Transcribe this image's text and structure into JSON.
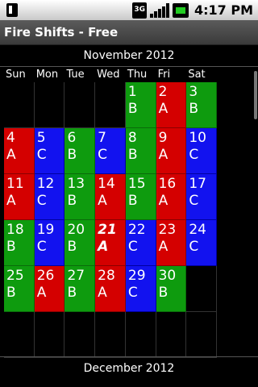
{
  "status_bar": {
    "network": "3G",
    "time": "4:17 PM"
  },
  "app": {
    "title": "Fire Shifts - Free"
  },
  "calendar": {
    "month_title": "November 2012",
    "next_month_title": "December 2012",
    "weekdays": [
      "Sun",
      "Mon",
      "Tue",
      "Wed",
      "Thu",
      "Fri",
      "Sat"
    ],
    "weeks": [
      [
        {
          "day": "",
          "shift": "",
          "color": "empty"
        },
        {
          "day": "",
          "shift": "",
          "color": "empty"
        },
        {
          "day": "",
          "shift": "",
          "color": "empty"
        },
        {
          "day": "",
          "shift": "",
          "color": "empty"
        },
        {
          "day": "1",
          "shift": "B",
          "color": "green"
        },
        {
          "day": "2",
          "shift": "A",
          "color": "red"
        },
        {
          "day": "3",
          "shift": "B",
          "color": "green"
        }
      ],
      [
        {
          "day": "4",
          "shift": "A",
          "color": "red"
        },
        {
          "day": "5",
          "shift": "C",
          "color": "blue"
        },
        {
          "day": "6",
          "shift": "B",
          "color": "green"
        },
        {
          "day": "7",
          "shift": "C",
          "color": "blue"
        },
        {
          "day": "8",
          "shift": "B",
          "color": "green"
        },
        {
          "day": "9",
          "shift": "A",
          "color": "red"
        },
        {
          "day": "10",
          "shift": "C",
          "color": "blue"
        }
      ],
      [
        {
          "day": "11",
          "shift": "A",
          "color": "red"
        },
        {
          "day": "12",
          "shift": "C",
          "color": "blue"
        },
        {
          "day": "13",
          "shift": "B",
          "color": "green"
        },
        {
          "day": "14",
          "shift": "A",
          "color": "red"
        },
        {
          "day": "15",
          "shift": "B",
          "color": "green"
        },
        {
          "day": "16",
          "shift": "A",
          "color": "red"
        },
        {
          "day": "17",
          "shift": "C",
          "color": "blue"
        }
      ],
      [
        {
          "day": "18",
          "shift": "B",
          "color": "green"
        },
        {
          "day": "19",
          "shift": "C",
          "color": "blue"
        },
        {
          "day": "20",
          "shift": "B",
          "color": "green"
        },
        {
          "day": "21",
          "shift": "A",
          "color": "red",
          "today": true
        },
        {
          "day": "22",
          "shift": "C",
          "color": "blue"
        },
        {
          "day": "23",
          "shift": "A",
          "color": "red"
        },
        {
          "day": "24",
          "shift": "C",
          "color": "blue"
        }
      ],
      [
        {
          "day": "25",
          "shift": "B",
          "color": "green"
        },
        {
          "day": "26",
          "shift": "A",
          "color": "red"
        },
        {
          "day": "27",
          "shift": "B",
          "color": "green"
        },
        {
          "day": "28",
          "shift": "A",
          "color": "red"
        },
        {
          "day": "29",
          "shift": "C",
          "color": "blue"
        },
        {
          "day": "30",
          "shift": "B",
          "color": "green"
        },
        {
          "day": "",
          "shift": "",
          "color": "empty"
        }
      ],
      [
        {
          "day": "",
          "shift": "",
          "color": "empty"
        },
        {
          "day": "",
          "shift": "",
          "color": "empty"
        },
        {
          "day": "",
          "shift": "",
          "color": "empty"
        },
        {
          "day": "",
          "shift": "",
          "color": "empty"
        },
        {
          "day": "",
          "shift": "",
          "color": "empty"
        },
        {
          "day": "",
          "shift": "",
          "color": "empty"
        },
        {
          "day": "",
          "shift": "",
          "color": "empty"
        }
      ]
    ]
  },
  "colors": {
    "A": "#d40000",
    "B": "#0e9b0e",
    "C": "#1212ef"
  }
}
